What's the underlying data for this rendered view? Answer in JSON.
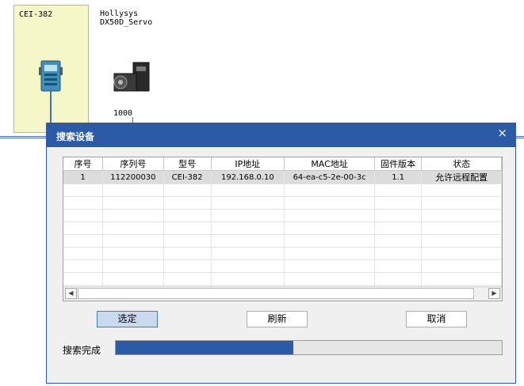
{
  "canvas": {
    "controller_label": "CEI-382",
    "device_name_line1": "Hollysys",
    "device_name_line2": "DX50D_Servo",
    "device_address": "1000"
  },
  "dialog": {
    "title": "搜索设备",
    "close_glyph": "×",
    "table": {
      "headers": [
        "序号",
        "序列号",
        "型号",
        "IP地址",
        "MAC地址",
        "固件版本",
        "状态"
      ],
      "rows": [
        [
          "1",
          "112200030",
          "CEI-382",
          "192.168.0.10",
          "64-ea-c5-2e-00-3c",
          "1.1",
          "允许远程配置"
        ]
      ]
    },
    "buttons": {
      "select": "选定",
      "refresh": "刷新",
      "cancel": "取消"
    },
    "status_text": "搜索完成",
    "progress": 0.46,
    "colors": {
      "accent": "#2b5aa7"
    }
  }
}
